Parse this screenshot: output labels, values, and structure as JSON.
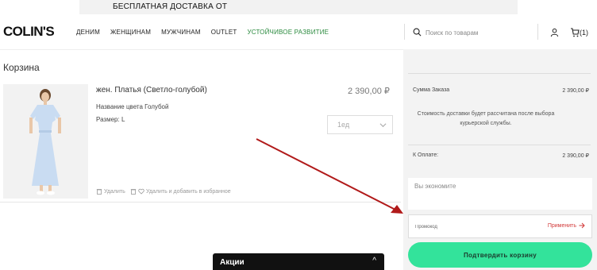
{
  "promo_strip": {
    "text": "БЕСПЛАТНАЯ ДОСТАВКА ОТ"
  },
  "header": {
    "logo": "COLIN'S",
    "nav": [
      "ДЕНИМ",
      "ЖЕНЩИНАМ",
      "МУЖЧИНАМ",
      "OUTLET",
      "УСТОЙЧИВОЕ РАЗВИТИЕ"
    ],
    "search_placeholder": "Поиск по товарам",
    "cart_count": "(1)"
  },
  "page_title": "Корзина",
  "product": {
    "name": "жен. Платья (Светло-голубой)",
    "price": "2 390,00 ₽",
    "color_label": "Название цвета Голубой",
    "size_label": "Размер: L",
    "quantity": "1ед",
    "delete_label": "Удалить",
    "wishlist_label": "Удалить и добавить в избранное"
  },
  "summary": {
    "order_total_label": "Сумма Заказа",
    "order_total_value": "2 390,00 ₽",
    "delivery_note": "Стоимость доставки будет рассчитана после выбора курьерской службы.",
    "to_pay_label": "К Оплате:",
    "to_pay_value": "2 390,00 ₽",
    "savings_label": "Вы экономите",
    "promo_placeholder": "Промокод",
    "apply_label": "Применить",
    "confirm_label": "Подтвердить корзину"
  },
  "promotions_bar": {
    "label": "Акции",
    "caret": "^"
  },
  "colors": {
    "accent_green": "#33e39b",
    "apply_red": "#d23a3a",
    "nav_green": "#2a8a3e",
    "arrow_red": "#b11a1a"
  }
}
